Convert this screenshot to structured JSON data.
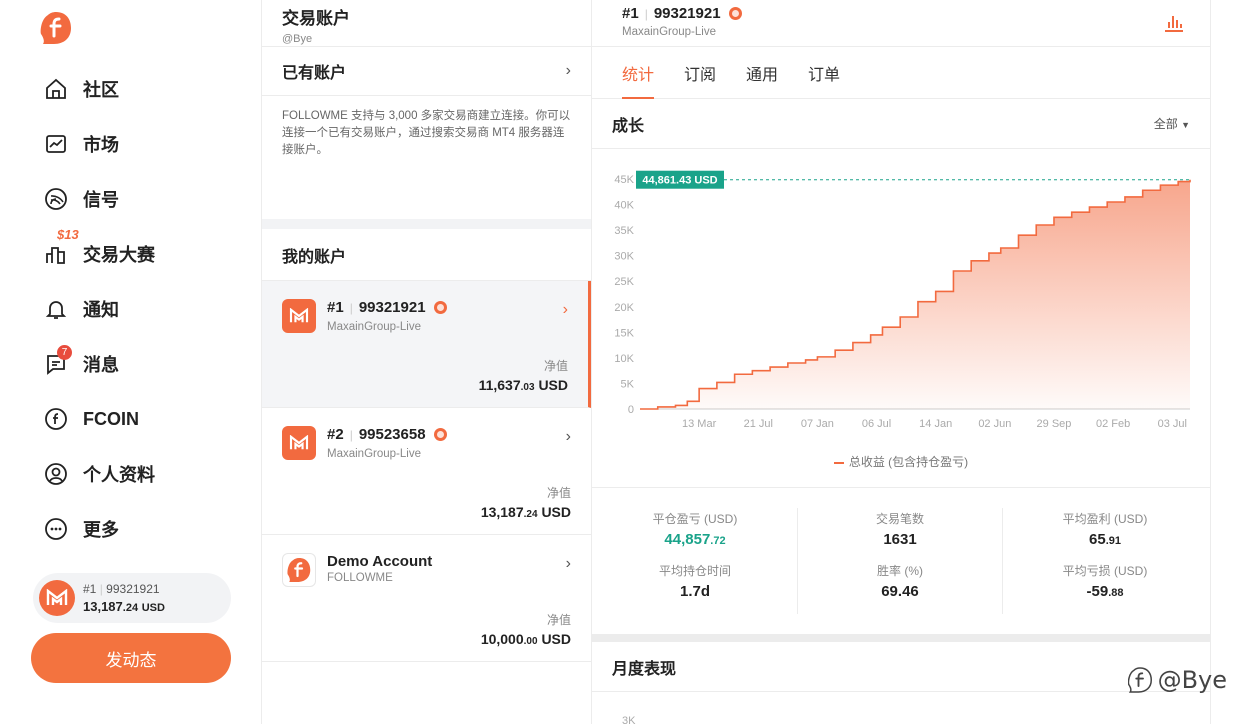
{
  "nav": {
    "items": [
      {
        "label": "社区",
        "icon": "home-icon"
      },
      {
        "label": "市场",
        "icon": "market-chart-icon"
      },
      {
        "label": "信号",
        "icon": "signal-icon"
      },
      {
        "label": "交易大赛",
        "icon": "contest-icon",
        "badge": "$13"
      },
      {
        "label": "通知",
        "icon": "bell-icon"
      },
      {
        "label": "消息",
        "icon": "message-icon",
        "badge": "7"
      },
      {
        "label": "FCOIN",
        "icon": "fcoin-icon"
      },
      {
        "label": "个人资料",
        "icon": "profile-icon"
      },
      {
        "label": "更多",
        "icon": "more-icon"
      }
    ],
    "account_card": {
      "rank": "#1",
      "number": "99321921",
      "equity_main": "13,187",
      "equity_dec": ".24",
      "currency": "USD"
    },
    "post_button": "发动态"
  },
  "middle": {
    "title": "交易账户",
    "handle": "@Bye",
    "existing_label": "已有账户",
    "description": "FOLLOWME 支持与 3,000 多家交易商建立连接。你可以连接一个已有交易账户，通过搜索交易商 MT4 服务器连接账户。",
    "my_accounts_label": "我的账户",
    "equity_label": "净值",
    "accounts": [
      {
        "rank": "#1",
        "number": "99321921",
        "server": "MaxainGroup-Live",
        "equity_main": "11,637",
        "equity_dec": ".03",
        "currency": "USD"
      },
      {
        "rank": "#2",
        "number": "99523658",
        "server": "MaxainGroup-Live",
        "equity_main": "13,187",
        "equity_dec": ".24",
        "currency": "USD"
      },
      {
        "name": "Demo Account",
        "server": "FOLLOWME",
        "equity_main": "10,000",
        "equity_dec": ".00",
        "currency": "USD"
      }
    ]
  },
  "right": {
    "rank": "#1",
    "number": "99321921",
    "server": "MaxainGroup-Live",
    "tabs": [
      "统计",
      "订阅",
      "通用",
      "订单"
    ],
    "growth_title": "成长",
    "filter": "全部",
    "monthly_title": "月度表现",
    "monthly_first_tick": "3K",
    "stats": [
      {
        "label": "平仓盈亏 (USD)",
        "main": "44,857",
        "dec": ".72",
        "green": true
      },
      {
        "label": "交易笔数",
        "main": "1631",
        "dec": ""
      },
      {
        "label": "平均盈利 (USD)",
        "main": "65",
        "dec": ".91"
      },
      {
        "label": "平均持仓时间",
        "main": "1.7d",
        "dec": ""
      },
      {
        "label": "胜率 (%)",
        "main": "69.46",
        "dec": ""
      },
      {
        "label": "平均亏损 (USD)",
        "main": "-59",
        "dec": ".88"
      }
    ]
  },
  "chart_data": {
    "type": "area",
    "title": "",
    "xlabel": "",
    "ylabel": "",
    "ylim": [
      0,
      45000
    ],
    "y_ticks": [
      "0",
      "5K",
      "10K",
      "15K",
      "20K",
      "25K",
      "30K",
      "35K",
      "40K",
      "45K"
    ],
    "x_ticks": [
      "13 Mar",
      "21 Jul",
      "07 Jan",
      "06 Jul",
      "14 Jan",
      "02 Jun",
      "29 Sep",
      "02 Feb",
      "03 Jul"
    ],
    "last_value_label": "44,861.43 USD",
    "series": [
      {
        "name": "总收益 (包含持仓盈亏)",
        "color": "#f26a3f",
        "x": [
          0,
          0.3,
          0.6,
          0.8,
          1.0,
          1.3,
          1.6,
          1.9,
          2.2,
          2.5,
          2.8,
          3.0,
          3.3,
          3.6,
          3.9,
          4.1,
          4.4,
          4.7,
          5.0,
          5.3,
          5.6,
          5.9,
          6.1,
          6.4,
          6.7,
          7.0,
          7.3,
          7.6,
          7.9,
          8.2,
          8.5,
          8.8,
          9.1,
          9.3
        ],
        "y": [
          0,
          400,
          700,
          1500,
          4000,
          5200,
          6800,
          7500,
          8200,
          9000,
          9600,
          10200,
          11500,
          13000,
          14500,
          16000,
          18000,
          21000,
          23000,
          27000,
          29000,
          30500,
          31500,
          34000,
          36000,
          37500,
          38500,
          39500,
          40500,
          41500,
          42800,
          43800,
          44500,
          44861
        ]
      }
    ]
  },
  "watermark": "@Bye",
  "colors": {
    "accent": "#f26a3f",
    "green": "#1aa38a"
  }
}
